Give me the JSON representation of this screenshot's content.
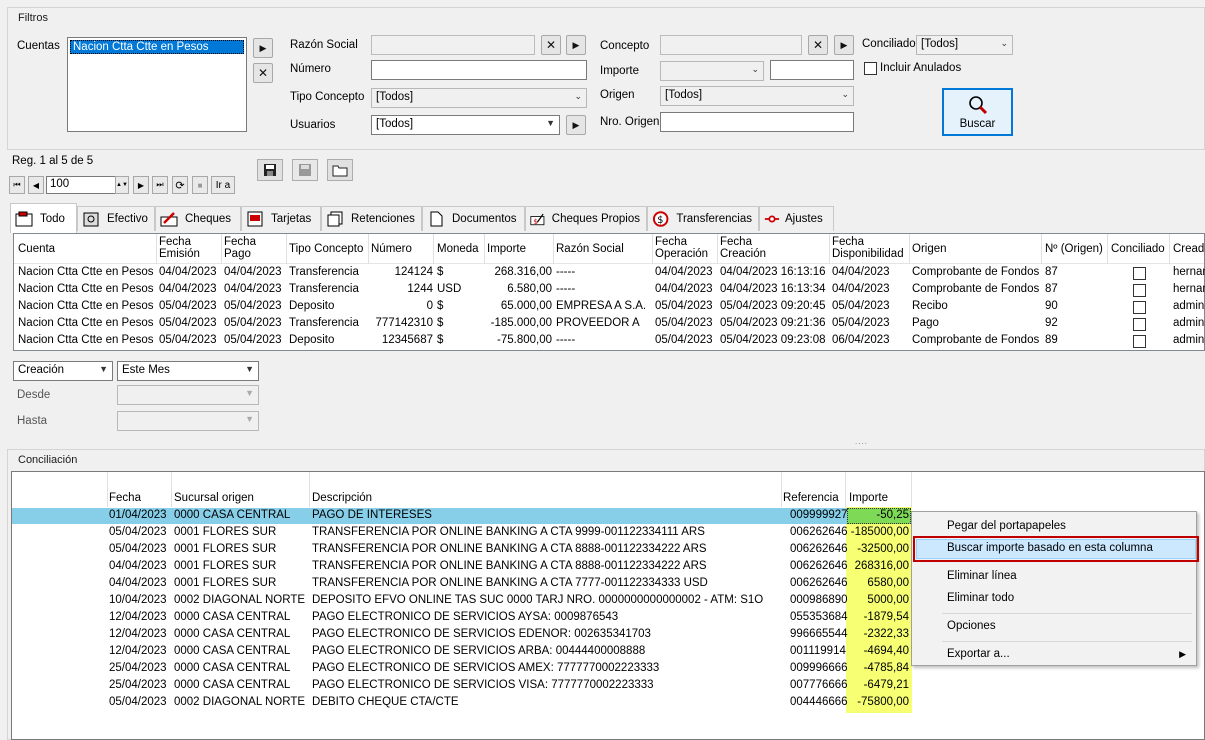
{
  "filtros": {
    "title": "Filtros",
    "cuentas_label": "Cuentas",
    "cuentas_selected": "Nacion Ctta Ctte en Pesos",
    "razon_social_label": "Razón Social",
    "razon_social_value": "",
    "numero_label": "Número",
    "numero_value": "",
    "tipo_concepto_label": "Tipo Concepto",
    "tipo_concepto_value": "[Todos]",
    "usuarios_label": "Usuarios",
    "usuarios_value": "[Todos]",
    "concepto_label": "Concepto",
    "concepto_value": "",
    "importe_label": "Importe",
    "importe_value": "",
    "origen_label": "Origen",
    "origen_value": "[Todos]",
    "nro_origen_label": "Nro. Origen",
    "nro_origen_value": "",
    "conciliado_label": "Conciliado",
    "conciliado_value": "[Todos]",
    "incluir_anulados_label": "Incluir Anulados",
    "buscar_label": "Buscar"
  },
  "paging": {
    "reg_text": "Reg. 1 al 5 de 5",
    "page_size": "100",
    "ira_label": "Ir a"
  },
  "tabs": [
    {
      "label": "Todo",
      "icon": "wallet-icon"
    },
    {
      "label": "Efectivo",
      "icon": "safe-icon"
    },
    {
      "label": "Cheques",
      "icon": "pen-check-icon"
    },
    {
      "label": "Tarjetas",
      "icon": "card-icon"
    },
    {
      "label": "Retenciones",
      "icon": "receipts-icon"
    },
    {
      "label": "Documentos",
      "icon": "document-icon"
    },
    {
      "label": "Cheques Propios",
      "icon": "signed-check-icon"
    },
    {
      "label": "Transferencias",
      "icon": "transfer-icon"
    },
    {
      "label": "Ajustes",
      "icon": "adjust-icon"
    }
  ],
  "movimientos": {
    "columns": [
      "Cuenta",
      "Fecha Emisión",
      "Fecha Pago",
      "Tipo Concepto",
      "Número",
      "Moneda",
      "Importe",
      "Razón Social",
      "Fecha Operación",
      "Fecha Creación",
      "Fecha Disponibilidad",
      "Origen",
      "Nº (Origen)",
      "Conciliado",
      "Creado"
    ],
    "rows": [
      [
        "Nacion Ctta Ctte en Pesos",
        "04/04/2023",
        "04/04/2023",
        "Transferencia",
        "124124",
        "$",
        "268.316,00",
        "-----",
        "04/04/2023",
        "04/04/2023 16:13:16",
        "04/04/2023",
        "Comprobante de Fondos",
        "87",
        "",
        "hernan"
      ],
      [
        "Nacion Ctta Ctte en Pesos",
        "04/04/2023",
        "04/04/2023",
        "Transferencia",
        "1244",
        "USD",
        "6.580,00",
        "-----",
        "04/04/2023",
        "04/04/2023 16:13:34",
        "04/04/2023",
        "Comprobante de Fondos",
        "87",
        "",
        "hernan"
      ],
      [
        "Nacion Ctta Ctte en Pesos",
        "05/04/2023",
        "05/04/2023",
        "Deposito",
        "0",
        "$",
        "65.000,00",
        "EMPRESA A S.A.",
        "05/04/2023",
        "05/04/2023 09:20:45",
        "05/04/2023",
        "Recibo",
        "90",
        "",
        "admin"
      ],
      [
        "Nacion Ctta Ctte en Pesos",
        "05/04/2023",
        "05/04/2023",
        "Transferencia",
        "777142310",
        "$",
        "-185.000,00",
        "PROVEEDOR A",
        "05/04/2023",
        "05/04/2023 09:21:36",
        "05/04/2023",
        "Pago",
        "92",
        "",
        "admin"
      ],
      [
        "Nacion Ctta Ctte en Pesos",
        "05/04/2023",
        "05/04/2023",
        "Deposito",
        "12345687",
        "$",
        "-75.800,00",
        "-----",
        "05/04/2023",
        "05/04/2023 09:23:08",
        "06/04/2023",
        "Comprobante de Fondos",
        "89",
        "",
        "admin"
      ]
    ]
  },
  "date_filter": {
    "field_value": "Creación",
    "range_value": "Este Mes",
    "desde_label": "Desde",
    "hasta_label": "Hasta"
  },
  "conciliacion": {
    "title": "Conciliación",
    "columns": [
      "Fecha",
      "Sucursal origen",
      "Descripción",
      "Referencia",
      "Importe"
    ],
    "rows": [
      [
        "01/04/2023",
        "0000 CASA CENTRAL",
        "PAGO DE INTERESES",
        "009999927",
        "-50,25"
      ],
      [
        "05/04/2023",
        "0001 FLORES SUR",
        "TRANSFERENCIA POR ONLINE BANKING A CTA 9999-001122334111 ARS",
        "006262646",
        "-185000,00"
      ],
      [
        "05/04/2023",
        "0001 FLORES SUR",
        "TRANSFERENCIA POR ONLINE BANKING A CTA 8888-001122334222 ARS",
        "006262646",
        "-32500,00"
      ],
      [
        "04/04/2023",
        "0001 FLORES SUR",
        "TRANSFERENCIA POR ONLINE BANKING A CTA 8888-001122334222 ARS",
        "006262646",
        "268316,00"
      ],
      [
        "04/04/2023",
        "0001 FLORES SUR",
        "TRANSFERENCIA POR ONLINE BANKING A CTA 7777-001122334333 USD",
        "006262646",
        "6580,00"
      ],
      [
        "10/04/2023",
        "0002 DIAGONAL NORTE",
        "DEPOSITO EFVO ONLINE TAS SUC 0000 TARJ NRO. 0000000000000002  - ATM: S1O",
        "000986890",
        "5000,00"
      ],
      [
        "12/04/2023",
        "0000 CASA CENTRAL",
        "PAGO ELECTRONICO DE SERVICIOS   AYSA: 0009876543",
        "055353684",
        "-1879,54"
      ],
      [
        "12/04/2023",
        "0000 CASA CENTRAL",
        "PAGO ELECTRONICO DE SERVICIOS   EDENOR: 002635341703",
        "996665544",
        "-2322,33"
      ],
      [
        "12/04/2023",
        "0000 CASA CENTRAL",
        "PAGO ELECTRONICO DE SERVICIOS   ARBA: 00444400008888",
        "001119914",
        "-4694,40"
      ],
      [
        "25/04/2023",
        "0000 CASA CENTRAL",
        "PAGO ELECTRONICO DE SERVICIOS AMEX: 7777770002223333",
        "009996666",
        "-4785,84"
      ],
      [
        "25/04/2023",
        "0000 CASA CENTRAL",
        "PAGO ELECTRONICO DE SERVICIOS VISA: 7777770002223333",
        "007776666",
        "-6479,21"
      ],
      [
        "05/04/2023",
        "0002 DIAGONAL NORTE",
        "DEBITO CHEQUE CTA/CTE",
        "004446666",
        "-75800,00"
      ]
    ]
  },
  "context_menu": {
    "items": [
      "Pegar del portapapeles",
      "Buscar importe basado en esta columna",
      "Eliminar línea",
      "Eliminar todo",
      "Opciones",
      "Exportar a..."
    ]
  },
  "colors": {
    "selection": "#0078d7",
    "row_highlight": "#87cee8",
    "importe_bg": "#f7ff73",
    "importe_selected": "#7ed957",
    "menu_highlight_border": "#c00000"
  }
}
